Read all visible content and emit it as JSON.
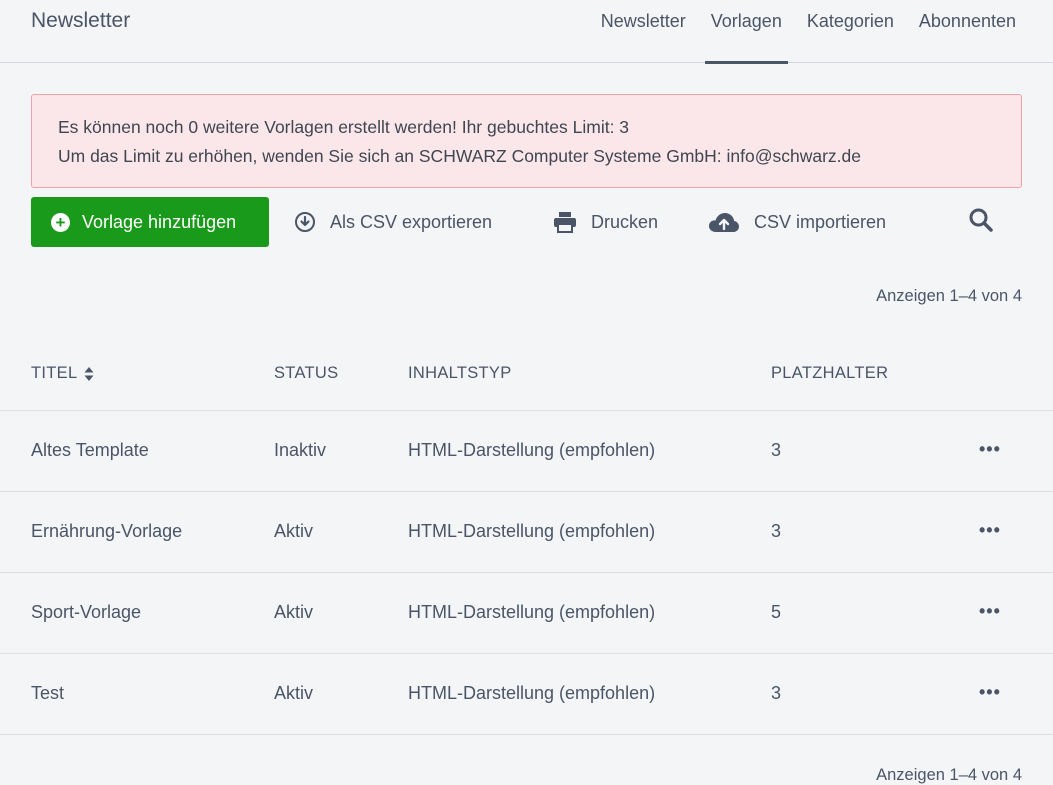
{
  "app": {
    "title": "Newsletter"
  },
  "nav": {
    "items": [
      {
        "label": "Newsletter"
      },
      {
        "label": "Vorlagen"
      },
      {
        "label": "Kategorien"
      },
      {
        "label": "Abonnenten"
      }
    ],
    "active": "Vorlagen"
  },
  "alert": {
    "line1": "Es können noch 0 weitere Vorlagen erstellt werden! Ihr gebuchtes Limit: 3",
    "line2": "Um das Limit zu erhöhen, wenden Sie sich an SCHWARZ Computer Systeme GmbH: info@schwarz.de"
  },
  "toolbar": {
    "add_label": "Vorlage hinzufügen",
    "export_label": "Als CSV exportieren",
    "print_label": "Drucken",
    "import_label": "CSV importieren"
  },
  "pagination": {
    "top": "Anzeigen 1–4 von 4",
    "bottom": "Anzeigen 1–4 von 4"
  },
  "table": {
    "columns": [
      "TITEL",
      "STATUS",
      "INHALTSTYP",
      "PLATZHALTER"
    ],
    "rows": [
      {
        "title": "Altes Template",
        "status": "Inaktiv",
        "type": "HTML-Darstellung (empfohlen)",
        "placeholders": "3"
      },
      {
        "title": "Ernährung-Vorlage",
        "status": "Aktiv",
        "type": "HTML-Darstellung (empfohlen)",
        "placeholders": "3"
      },
      {
        "title": "Sport-Vorlage",
        "status": "Aktiv",
        "type": "HTML-Darstellung (empfohlen)",
        "placeholders": "5"
      },
      {
        "title": "Test",
        "status": "Aktiv",
        "type": "HTML-Darstellung (empfohlen)",
        "placeholders": "3"
      }
    ],
    "row_menu": "•••"
  },
  "icons": {
    "add": "plus-circle-icon",
    "export": "download-circle-icon",
    "print": "printer-icon",
    "import": "cloud-upload-icon",
    "search": "search-icon",
    "sort": "sort-icon"
  },
  "colors": {
    "primary": "#1a9a1a",
    "alert_bg": "#fbe7e9",
    "alert_border": "#f3a1a9",
    "text": "#4a5568"
  }
}
